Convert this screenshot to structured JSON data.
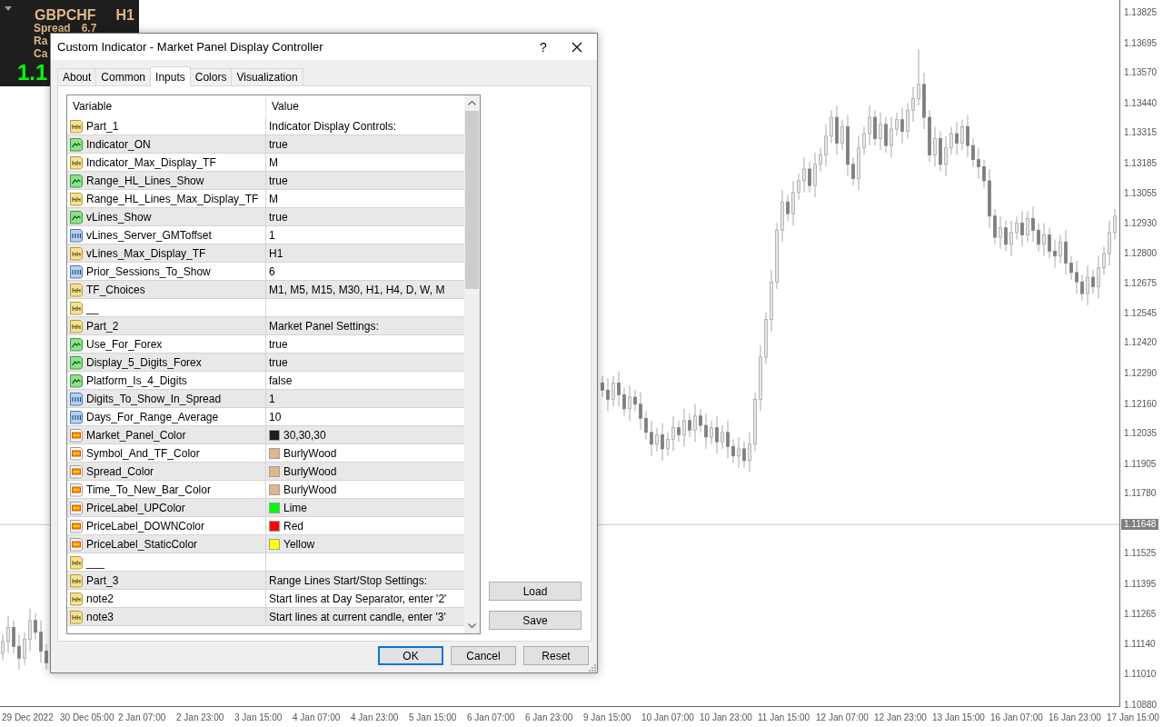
{
  "market_panel": {
    "symbol": "GBPCHF",
    "timeframe": "H1",
    "spread_label": "Spread",
    "spread": "6.7",
    "line_3": "Ra",
    "line_4": "Ca",
    "price": "1.1"
  },
  "chart": {
    "current_price": "1.11648",
    "time_labels": [
      "29 Dec 2022",
      "30 Dec 05:00",
      "2 Jan 07:00",
      "2 Jan 23:00",
      "3 Jan 15:00",
      "4 Jan 07:00",
      "4 Jan 23:00",
      "5 Jan 15:00",
      "6 Jan 07:00",
      "6 Jan 23:00",
      "9 Jan 15:00",
      "10 Jan 07:00",
      "10 Jan 23:00",
      "11 Jan 15:00",
      "12 Jan 07:00",
      "12 Jan 23:00",
      "13 Jan 15:00",
      "16 Jan 07:00",
      "16 Jan 23:00",
      "17 Jan 15:00"
    ],
    "chart_data": {
      "type": "candlestick",
      "ylim": [
        1.10872,
        1.13879
      ],
      "ref_lines": [
        {
          "axis": "y",
          "value": 1.11648
        }
      ],
      "yticks": [
        {
          "value": 1.13825,
          "label": "1.13825"
        },
        {
          "value": 1.13695,
          "label": "1.13695"
        },
        {
          "value": 1.1357,
          "label": "1.13570"
        },
        {
          "value": 1.1344,
          "label": "1.13440"
        },
        {
          "value": 1.13315,
          "label": "1.13315"
        },
        {
          "value": 1.13185,
          "label": "1.13185"
        },
        {
          "value": 1.13055,
          "label": "1.13055"
        },
        {
          "value": 1.1293,
          "label": "1.12930"
        },
        {
          "value": 1.128,
          "label": "1.12800"
        },
        {
          "value": 1.12675,
          "label": "1.12675"
        },
        {
          "value": 1.12545,
          "label": "1.12545"
        },
        {
          "value": 1.1242,
          "label": "1.12420"
        },
        {
          "value": 1.1229,
          "label": "1.12290"
        },
        {
          "value": 1.1216,
          "label": "1.12160"
        },
        {
          "value": 1.12035,
          "label": "1.12035"
        },
        {
          "value": 1.11905,
          "label": "1.11905"
        },
        {
          "value": 1.1178,
          "label": "1.11780"
        },
        {
          "value": 1.11525,
          "label": "1.11525"
        },
        {
          "value": 1.11395,
          "label": "1.11395"
        },
        {
          "value": 1.11265,
          "label": "1.11265"
        },
        {
          "value": 1.1114,
          "label": "1.11140"
        },
        {
          "value": 1.1101,
          "label": "1.11010"
        },
        {
          "value": 1.1088,
          "label": "1.10880"
        }
      ],
      "categories": [
        null,
        null,
        null,
        null,
        null,
        null,
        null,
        null,
        null,
        null,
        null,
        null,
        null,
        null,
        null,
        null,
        null,
        null,
        null,
        null,
        null,
        null,
        null,
        null,
        null,
        null,
        null,
        null,
        null,
        null,
        null,
        null,
        null,
        null,
        null,
        null,
        null,
        null,
        null,
        null,
        null,
        null,
        null,
        null,
        null,
        null,
        null,
        null,
        null,
        null,
        null,
        null,
        null,
        null,
        null,
        null,
        null,
        null,
        null,
        null,
        null,
        null,
        null,
        null,
        null,
        null,
        null,
        null,
        null,
        null,
        null,
        null,
        null,
        null,
        null,
        null,
        null,
        null,
        null,
        null,
        null,
        null,
        null,
        null,
        null,
        null,
        null,
        null,
        null,
        null,
        null,
        null,
        null,
        null,
        null,
        null,
        null,
        null,
        null,
        null,
        null,
        null,
        null,
        null,
        null,
        null,
        null,
        null,
        null,
        null,
        null,
        null,
        null,
        null,
        null,
        null,
        null,
        null,
        null,
        null,
        null,
        null,
        null,
        null,
        null,
        null,
        null,
        null,
        null,
        null,
        null,
        null,
        null,
        null,
        null,
        null,
        null,
        null,
        null,
        null,
        null,
        null,
        null,
        null,
        null,
        null,
        null,
        null,
        null,
        null,
        null,
        null,
        null,
        null,
        null,
        null,
        null,
        null,
        null,
        null,
        null,
        null,
        null,
        null,
        null,
        null,
        null,
        null,
        null,
        null,
        null,
        null,
        null,
        null,
        null,
        null,
        null,
        null,
        null,
        null,
        null,
        null,
        null,
        null,
        null,
        null,
        null,
        null,
        null,
        null,
        null,
        null,
        null,
        null,
        null,
        null,
        null,
        null,
        null,
        null,
        null,
        null,
        null,
        null,
        null
      ],
      "ohlc": [
        [
          1.111,
          1.1118,
          1.1107,
          1.1115
        ],
        [
          1.1115,
          1.1126,
          1.111,
          1.1121
        ],
        [
          1.1121,
          1.1124,
          1.111,
          1.1113
        ],
        [
          1.1113,
          1.1118,
          1.1103,
          1.1108
        ],
        [
          1.1108,
          1.1119,
          1.1105,
          1.1116
        ],
        [
          1.1116,
          1.1129,
          1.1111,
          1.1124
        ],
        [
          1.1124,
          1.1127,
          1.1116,
          1.1119
        ],
        [
          1.1119,
          1.1124,
          1.1106,
          1.1111
        ],
        [
          1.1111,
          1.1114,
          1.1103,
          1.1106
        ],
        null,
        null,
        null,
        null,
        null,
        null,
        null,
        null,
        null,
        null,
        null,
        null,
        null,
        null,
        null,
        null,
        null,
        null,
        null,
        null,
        null,
        null,
        null,
        null,
        null,
        null,
        null,
        null,
        null,
        null,
        null,
        null,
        null,
        null,
        null,
        null,
        null,
        null,
        null,
        null,
        null,
        null,
        null,
        null,
        null,
        null,
        null,
        null,
        null,
        null,
        null,
        null,
        null,
        null,
        null,
        null,
        null,
        null,
        null,
        null,
        null,
        null,
        null,
        null,
        null,
        null,
        null,
        null,
        null,
        null,
        null,
        null,
        null,
        null,
        null,
        null,
        null,
        null,
        null,
        null,
        null,
        null,
        null,
        null,
        null,
        null,
        null,
        null,
        null,
        null,
        null,
        null,
        null,
        null,
        null,
        null,
        null,
        null,
        null,
        null,
        null,
        [
          1.1225,
          1.1228,
          1.1219,
          1.1222
        ],
        [
          1.1222,
          1.1227,
          1.1213,
          1.1218
        ],
        [
          1.1218,
          1.1228,
          1.1215,
          1.1225
        ],
        [
          1.1225,
          1.123,
          1.1215,
          1.122
        ],
        [
          1.122,
          1.1223,
          1.1211,
          1.1214
        ],
        [
          1.1214,
          1.1224,
          1.1209,
          1.1219
        ],
        [
          1.1219,
          1.1222,
          1.1213,
          1.1216
        ],
        [
          1.1216,
          1.1221,
          1.1205,
          1.121
        ],
        [
          1.121,
          1.1213,
          1.1201,
          1.1204
        ],
        [
          1.1204,
          1.1209,
          1.1194,
          1.1199
        ],
        [
          1.1199,
          1.1206,
          1.1196,
          1.1203
        ],
        [
          1.1203,
          1.1208,
          1.1192,
          1.1197
        ],
        [
          1.1197,
          1.1204,
          1.1194,
          1.1201
        ],
        [
          1.1201,
          1.1211,
          1.1196,
          1.1206
        ],
        [
          1.1206,
          1.1209,
          1.12,
          1.1203
        ],
        [
          1.1203,
          1.1214,
          1.1198,
          1.1209
        ],
        [
          1.1209,
          1.1212,
          1.1202,
          1.1205
        ],
        [
          1.1205,
          1.1216,
          1.12,
          1.1211
        ],
        [
          1.1211,
          1.1214,
          1.1204,
          1.1207
        ],
        [
          1.1207,
          1.1212,
          1.1197,
          1.1202
        ],
        [
          1.1202,
          1.1209,
          1.1199,
          1.1206
        ],
        [
          1.1206,
          1.1211,
          1.1195,
          1.12
        ],
        [
          1.12,
          1.1207,
          1.1197,
          1.1204
        ],
        [
          1.1204,
          1.1209,
          1.1193,
          1.1198
        ],
        [
          1.1198,
          1.1201,
          1.1191,
          1.1194
        ],
        [
          1.1194,
          1.1202,
          1.1189,
          1.1197
        ],
        [
          1.1197,
          1.12,
          1.1189,
          1.1192
        ],
        [
          1.1192,
          1.1204,
          1.1187,
          1.1199
        ],
        [
          1.1199,
          1.1221,
          1.1196,
          1.1218
        ],
        [
          1.1218,
          1.1241,
          1.1213,
          1.1236
        ],
        [
          1.1236,
          1.1255,
          1.1233,
          1.1252
        ],
        [
          1.1252,
          1.1273,
          1.1247,
          1.1268
        ],
        [
          1.1268,
          1.1293,
          1.1265,
          1.129
        ],
        [
          1.129,
          1.1307,
          1.1285,
          1.1302
        ],
        [
          1.1302,
          1.1305,
          1.1294,
          1.1297
        ],
        [
          1.1297,
          1.1311,
          1.1292,
          1.1306
        ],
        [
          1.1306,
          1.1314,
          1.1303,
          1.1311
        ],
        [
          1.1311,
          1.1321,
          1.1306,
          1.1316
        ],
        [
          1.1316,
          1.1319,
          1.1306,
          1.1309
        ],
        [
          1.1309,
          1.1323,
          1.1304,
          1.1318
        ],
        [
          1.1318,
          1.1325,
          1.1315,
          1.1322
        ],
        [
          1.1322,
          1.1335,
          1.1317,
          1.133
        ],
        [
          1.133,
          1.1341,
          1.1327,
          1.1338
        ],
        [
          1.1338,
          1.1343,
          1.1322,
          1.1327
        ],
        [
          1.1327,
          1.1337,
          1.1324,
          1.1334
        ],
        [
          1.1334,
          1.1339,
          1.1313,
          1.1318
        ],
        [
          1.1318,
          1.1321,
          1.1309,
          1.1312
        ],
        [
          1.1312,
          1.133,
          1.1307,
          1.1325
        ],
        [
          1.1325,
          1.1334,
          1.1322,
          1.1331
        ],
        [
          1.1331,
          1.1343,
          1.1326,
          1.1338
        ],
        [
          1.1338,
          1.1341,
          1.1326,
          1.1329
        ],
        [
          1.1329,
          1.134,
          1.1324,
          1.1335
        ],
        [
          1.1335,
          1.1338,
          1.1323,
          1.1326
        ],
        [
          1.1326,
          1.1338,
          1.1321,
          1.1333
        ],
        [
          1.1333,
          1.134,
          1.133,
          1.1337
        ],
        [
          1.1337,
          1.1342,
          1.1327,
          1.1332
        ],
        [
          1.1332,
          1.1344,
          1.1329,
          1.1341
        ],
        [
          1.1341,
          1.1351,
          1.1336,
          1.1346
        ],
        [
          1.1346,
          1.1367,
          1.1343,
          1.1352
        ],
        [
          1.1352,
          1.1357,
          1.1333,
          1.1338
        ],
        [
          1.1338,
          1.1341,
          1.1319,
          1.1322
        ],
        [
          1.1322,
          1.1334,
          1.1317,
          1.1329
        ],
        [
          1.1329,
          1.1332,
          1.1315,
          1.1318
        ],
        [
          1.1318,
          1.133,
          1.1313,
          1.1325
        ],
        [
          1.1325,
          1.1334,
          1.1322,
          1.1331
        ],
        [
          1.1331,
          1.1336,
          1.1322,
          1.1327
        ],
        [
          1.1327,
          1.1337,
          1.1324,
          1.1334
        ],
        [
          1.1334,
          1.1339,
          1.1321,
          1.1326
        ],
        [
          1.1326,
          1.1329,
          1.1317,
          1.132
        ],
        [
          1.132,
          1.1325,
          1.1312,
          1.1317
        ],
        [
          1.1317,
          1.132,
          1.1308,
          1.1311
        ],
        [
          1.1311,
          1.1316,
          1.1291,
          1.1296
        ],
        [
          1.1296,
          1.1299,
          1.1284,
          1.1287
        ],
        [
          1.1287,
          1.1296,
          1.1282,
          1.1291
        ],
        [
          1.1291,
          1.1294,
          1.1281,
          1.1284
        ],
        [
          1.1284,
          1.1294,
          1.1279,
          1.1289
        ],
        [
          1.1289,
          1.1296,
          1.1286,
          1.1293
        ],
        [
          1.1293,
          1.1298,
          1.1283,
          1.1288
        ],
        [
          1.1288,
          1.1298,
          1.1285,
          1.1295
        ],
        [
          1.1295,
          1.13,
          1.1285,
          1.129
        ],
        [
          1.129,
          1.1293,
          1.1281,
          1.1284
        ],
        [
          1.1284,
          1.1293,
          1.1279,
          1.1288
        ],
        [
          1.1288,
          1.1291,
          1.1278,
          1.1281
        ],
        [
          1.1281,
          1.1286,
          1.1274,
          1.1279
        ],
        [
          1.1279,
          1.1288,
          1.1276,
          1.1285
        ],
        [
          1.1285,
          1.129,
          1.1271,
          1.1276
        ],
        [
          1.1276,
          1.1279,
          1.1269,
          1.1272
        ],
        [
          1.1272,
          1.1277,
          1.1263,
          1.1268
        ],
        [
          1.1268,
          1.1271,
          1.126,
          1.1263
        ],
        [
          1.1263,
          1.1275,
          1.1258,
          1.127
        ],
        [
          1.127,
          1.1273,
          1.1263,
          1.1266
        ],
        [
          1.1266,
          1.1279,
          1.1261,
          1.1274
        ],
        [
          1.1274,
          1.1283,
          1.1271,
          1.128
        ],
        [
          1.128,
          1.1294,
          1.1275,
          1.1289
        ],
        [
          1.1289,
          1.1299,
          1.1286,
          1.1296
        ]
      ]
    }
  },
  "dialog": {
    "title": "Custom Indicator - Market Panel Display Controller",
    "help": "?",
    "tabs": [
      {
        "label": "About",
        "selected": false
      },
      {
        "label": "Common",
        "selected": false
      },
      {
        "label": "Inputs",
        "selected": true
      },
      {
        "label": "Colors",
        "selected": false
      },
      {
        "label": "Visualization",
        "selected": false
      }
    ],
    "table": {
      "columns": [
        "Variable",
        "Value"
      ],
      "rows": [
        {
          "kind": "string",
          "variable": "Part_1",
          "value": "Indicator Display Controls:"
        },
        {
          "kind": "bool",
          "variable": "Indicator_ON",
          "value": "true"
        },
        {
          "kind": "string",
          "variable": "Indicator_Max_Display_TF",
          "value": "M"
        },
        {
          "kind": "bool",
          "variable": "Range_HL_Lines_Show",
          "value": "true"
        },
        {
          "kind": "string",
          "variable": "Range_HL_Lines_Max_Display_TF",
          "value": "M"
        },
        {
          "kind": "bool",
          "variable": "vLines_Show",
          "value": "true"
        },
        {
          "kind": "int",
          "variable": "vLines_Server_GMToffset",
          "value": "1"
        },
        {
          "kind": "string",
          "variable": "vLines_Max_Display_TF",
          "value": "H1"
        },
        {
          "kind": "int",
          "variable": "Prior_Sessions_To_Show",
          "value": "6"
        },
        {
          "kind": "string",
          "variable": "TF_Choices",
          "value": "M1, M5, M15, M30, H1, H4, D, W, M"
        },
        {
          "kind": "string",
          "variable": "__"
        },
        {
          "kind": "string",
          "variable": "Part_2",
          "value": "Market Panel Settings:"
        },
        {
          "kind": "bool",
          "variable": "Use_For_Forex",
          "value": "true"
        },
        {
          "kind": "bool",
          "variable": "Display_5_Digits_Forex",
          "value": "true"
        },
        {
          "kind": "bool",
          "variable": "Platform_Is_4_Digits",
          "value": "false"
        },
        {
          "kind": "int",
          "variable": "Digits_To_Show_In_Spread",
          "value": "1"
        },
        {
          "kind": "int",
          "variable": "Days_For_Range_Average",
          "value": "10"
        },
        {
          "kind": "color",
          "variable": "Market_Panel_Color",
          "value": "30,30,30",
          "color": "#1e1e1e"
        },
        {
          "kind": "color",
          "variable": "Symbol_And_TF_Color",
          "value": "BurlyWood",
          "color": "#deb887"
        },
        {
          "kind": "color",
          "variable": "Spread_Color",
          "value": "BurlyWood",
          "color": "#deb887"
        },
        {
          "kind": "color",
          "variable": "Time_To_New_Bar_Color",
          "value": "BurlyWood",
          "color": "#deb887"
        },
        {
          "kind": "color",
          "variable": "PriceLabel_UPColor",
          "value": "Lime",
          "color": "#00ff00"
        },
        {
          "kind": "color",
          "variable": "PriceLabel_DOWNColor",
          "value": "Red",
          "color": "#ff0000"
        },
        {
          "kind": "color",
          "variable": "PriceLabel_StaticColor",
          "value": "Yellow",
          "color": "#ffff00"
        },
        {
          "kind": "string",
          "variable": "___"
        },
        {
          "kind": "string",
          "variable": "Part_3",
          "value": "Range Lines Start/Stop Settings:"
        },
        {
          "kind": "string",
          "variable": "note2",
          "value": "Start lines at Day Separator, enter '2'"
        },
        {
          "kind": "string",
          "variable": "note3",
          "value": "Start lines at current candle, enter '3'"
        }
      ]
    },
    "side_buttons": [
      "Load",
      "Save"
    ],
    "buttons": [
      {
        "label": "OK",
        "default": true
      },
      {
        "label": "Cancel",
        "default": false
      },
      {
        "label": "Reset",
        "default": false
      }
    ]
  }
}
